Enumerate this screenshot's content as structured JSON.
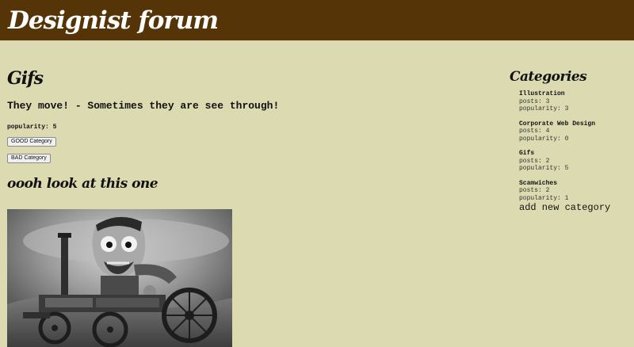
{
  "header": {
    "site_title": "Designist forum"
  },
  "category": {
    "title": "Gifs",
    "description": "They move! - Sometimes they are see through!",
    "popularity": "popularity: 5",
    "good_button": "GOOD Category",
    "bad_button": "BAD Category"
  },
  "post": {
    "title": "oooh look at this one"
  },
  "sidebar": {
    "title": "Categories",
    "items": [
      {
        "name": "Illustration",
        "posts": "posts: 3",
        "popularity": "popularity: 3"
      },
      {
        "name": "Corporate Web Design",
        "posts": "posts: 4",
        "popularity": "popularity: 0"
      },
      {
        "name": "Gifs",
        "posts": "posts: 2",
        "popularity": "popularity: 5"
      },
      {
        "name": "Scamwiches",
        "posts": "posts: 2",
        "popularity": "popularity: 1"
      }
    ],
    "add_link": "add new category"
  },
  "colors": {
    "background": "#dcdab0",
    "header": "#553508",
    "header_text": "#ffffff"
  }
}
